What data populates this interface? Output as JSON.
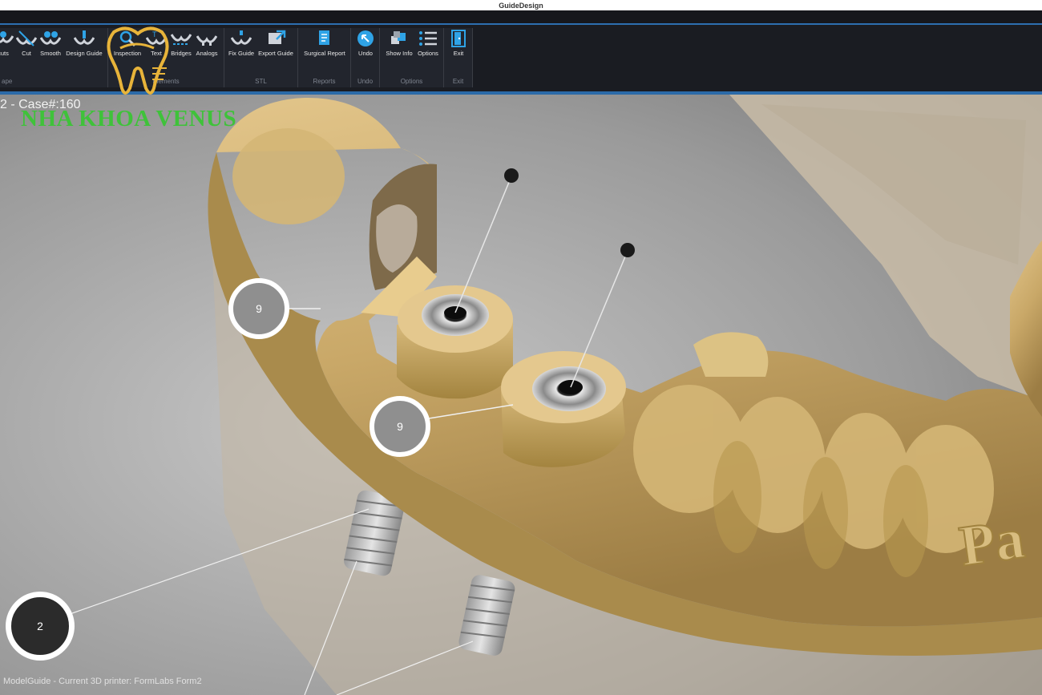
{
  "window": {
    "title": "GuideDesign"
  },
  "ribbon": {
    "groups": [
      {
        "label": "ape",
        "tools": [
          {
            "label": "cuts",
            "icon": "undercuts-icon"
          },
          {
            "label": "Cut",
            "icon": "cut-icon"
          },
          {
            "label": "Smooth",
            "icon": "smooth-icon"
          },
          {
            "label": "Design Guide",
            "icon": "design-guide-icon"
          }
        ]
      },
      {
        "label": "Elements",
        "tools": [
          {
            "label": "Inspection",
            "icon": "inspection-icon"
          },
          {
            "label": "Text",
            "icon": "text-icon"
          },
          {
            "label": "Bridges",
            "icon": "bridges-icon"
          },
          {
            "label": "Analogs",
            "icon": "analogs-icon"
          }
        ]
      },
      {
        "label": "STL",
        "tools": [
          {
            "label": "Fix Guide",
            "icon": "fix-guide-icon"
          },
          {
            "label": "Export Guide",
            "icon": "export-guide-icon"
          }
        ]
      },
      {
        "label": "Reports",
        "tools": [
          {
            "label": "Surgical Report",
            "icon": "surgical-report-icon"
          }
        ]
      },
      {
        "label": "Undo",
        "tools": [
          {
            "label": "Undo",
            "icon": "undo-icon"
          }
        ]
      },
      {
        "label": "Options",
        "tools": [
          {
            "label": "Show Info",
            "icon": "show-info-icon"
          },
          {
            "label": "Options",
            "icon": "options-icon"
          }
        ]
      },
      {
        "label": "Exit",
        "tools": [
          {
            "label": "Exit",
            "icon": "exit-icon"
          }
        ]
      }
    ]
  },
  "viewport": {
    "case_label": "2 - Case#:160",
    "watermark": "NHA KHOA VENUS",
    "markers": [
      {
        "label": "9"
      },
      {
        "label": "9"
      },
      {
        "label": "2"
      }
    ],
    "embossed_text": "Pa"
  },
  "status": {
    "text": "ModelGuide - Current 3D printer: FormLabs Form2"
  },
  "colors": {
    "ribbon": "#1a1c22",
    "accent": "#2d6fb0",
    "guide": "#c9a868",
    "watermark": "#3fc23a"
  }
}
